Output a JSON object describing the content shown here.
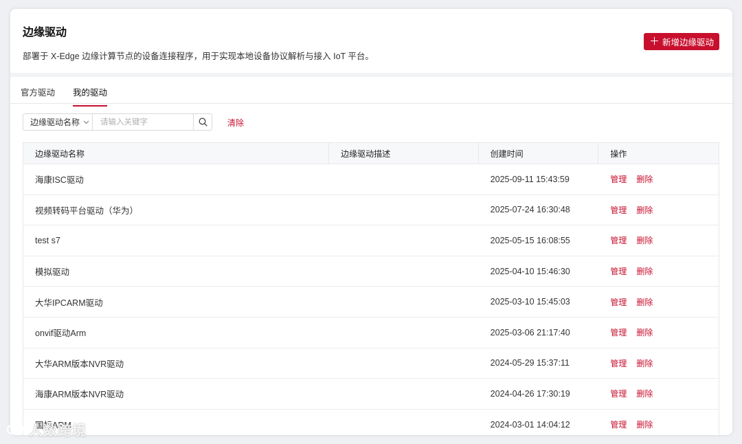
{
  "header": {
    "title": "边缘驱动",
    "description": "部署于 X-Edge 边缘计算节点的设备连接程序，用于实现本地设备协议解析与接入 IoT 平台。",
    "add_button": "新增边缘驱动"
  },
  "tabs": [
    {
      "label": "官方驱动",
      "active": false
    },
    {
      "label": "我的驱动",
      "active": true
    }
  ],
  "filter": {
    "field": "边缘驱动名称",
    "placeholder": "请输入关键字",
    "clear_label": "清除"
  },
  "table": {
    "columns": [
      "边缘驱动名称",
      "边缘驱动描述",
      "创建时间",
      "操作"
    ],
    "rows": [
      {
        "name": "海康ISC驱动",
        "description": "",
        "created": "2025-09-11 15:43:59"
      },
      {
        "name": "视频转码平台驱动（华为）",
        "description": "",
        "created": "2025-07-24 16:30:48"
      },
      {
        "name": "test s7",
        "description": "",
        "created": "2025-05-15 16:08:55"
      },
      {
        "name": "模拟驱动",
        "description": "",
        "created": "2025-04-10 15:46:30"
      },
      {
        "name": "大华IPCARM驱动",
        "description": "",
        "created": "2025-03-10 15:45:03"
      },
      {
        "name": "onvif驱动Arm",
        "description": "",
        "created": "2025-03-06 21:17:40"
      },
      {
        "name": "大华ARM版本NVR驱动",
        "description": "",
        "created": "2024-05-29 15:37:11"
      },
      {
        "name": "海康ARM版本NVR驱动",
        "description": "",
        "created": "2024-04-26 17:30:19"
      },
      {
        "name": "国标ARM",
        "description": "",
        "created": "2024-03-01 14:04:12"
      }
    ],
    "actions": {
      "manage": "管理",
      "delete": "删除"
    }
  },
  "watermark": "人数跨境",
  "colors": {
    "accent": "#c8102e",
    "header_bg": "#f7f8fa",
    "page_bg": "#eef0f3"
  },
  "icons": {
    "search": "search-icon",
    "plus": "plus-icon",
    "chevron": "chevron-down-icon"
  }
}
